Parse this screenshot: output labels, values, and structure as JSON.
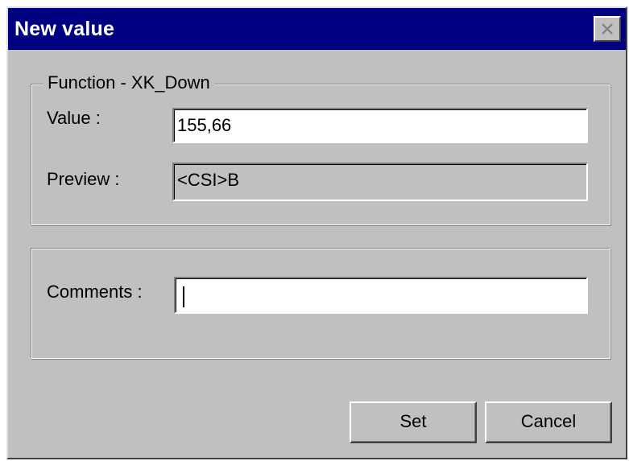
{
  "window": {
    "title": "New value"
  },
  "function_group": {
    "legend": "Function - XK_Down",
    "value_label": "Value :",
    "value": "155,66",
    "preview_label": "Preview :",
    "preview": "<CSI>B"
  },
  "comments_group": {
    "comments_label": "Comments :",
    "comments_value": ""
  },
  "buttons": {
    "set": "Set",
    "cancel": "Cancel"
  },
  "icons": {
    "close": "close-icon"
  },
  "colors": {
    "titlebar": "#000080",
    "face": "#c0c0c0"
  }
}
